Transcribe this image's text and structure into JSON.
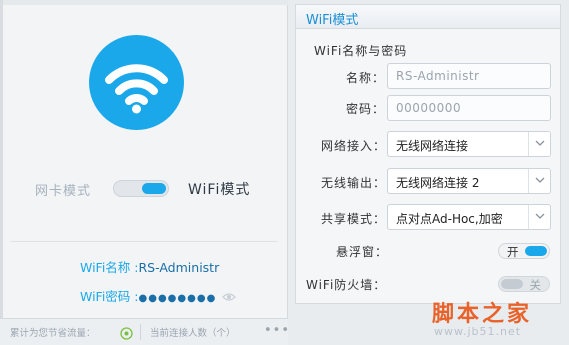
{
  "left": {
    "mode": {
      "nic_label": "网卡模式",
      "wifi_label": "WiFi模式",
      "active": "wifi"
    },
    "wifi_name_label": "WiFi名称 :",
    "wifi_name_value": "RS-Administr",
    "wifi_password_label": "WiFi密码 :",
    "wifi_password_value": "●●●●●●●●",
    "bottom": {
      "traffic_label": "累计为您节省流量：",
      "connections_label": "当前连接人数（个）",
      "more": "•••"
    }
  },
  "right": {
    "header_title": "WiFi模式",
    "section_title": "WiFi名称与密码",
    "name_label": "名称：",
    "name_placeholder": "RS-Administr",
    "password_label": "密码：",
    "password_placeholder": "00000000",
    "network_in_label": "网络接入：",
    "network_in_value": "无线网络连接",
    "wireless_out_label": "无线输出：",
    "wireless_out_value": "无线网络连接 2",
    "share_mode_label": "共享模式：",
    "share_mode_value": "点对点Ad-Hoc,加密",
    "float_window_label": "悬浮窗：",
    "float_window_state": "开",
    "float_window_on": true,
    "firewall_label": "WiFi防火墙：",
    "firewall_state": "关",
    "firewall_on": false
  },
  "watermark": {
    "title": "脚本之家",
    "url": "www.jb51.net"
  },
  "colors": {
    "accent": "#1ba8ea",
    "watermark": "#e8622a"
  }
}
